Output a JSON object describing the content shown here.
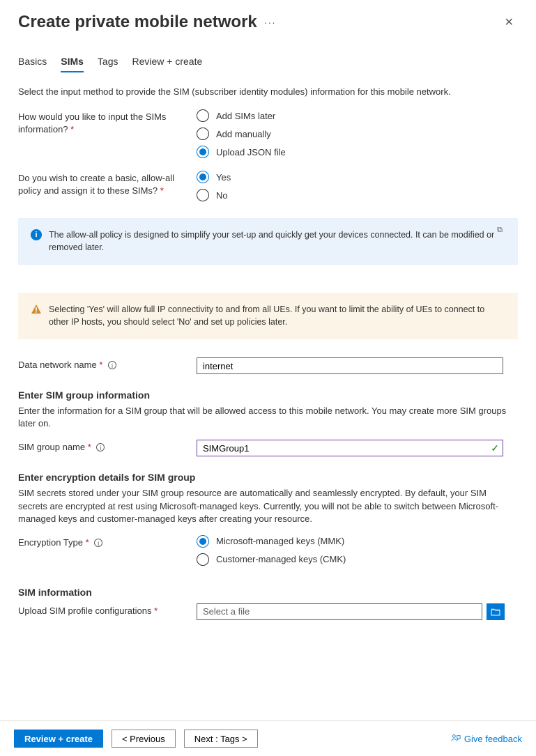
{
  "header": {
    "title": "Create private mobile network",
    "ellipsis": "···",
    "close": "✕"
  },
  "tabs": [
    "Basics",
    "SIMs",
    "Tags",
    "Review + create"
  ],
  "active_tab": "SIMs",
  "intro": "Select the input method to provide the SIM (subscriber identity modules) information for this mobile network.",
  "input_method": {
    "label": "How would you like to input the SIMs information?",
    "options": [
      "Add SIMs later",
      "Add manually",
      "Upload JSON file"
    ],
    "selected": "Upload JSON file"
  },
  "allow_all": {
    "label": "Do you wish to create a basic, allow-all policy and assign it to these SIMs?",
    "options": [
      "Yes",
      "No"
    ],
    "selected": "Yes"
  },
  "info_alert": "The allow-all policy is designed to simplify your set-up and quickly get your devices connected. It can be modified or removed later.",
  "warn_alert": "Selecting 'Yes' will allow full IP connectivity to and from all UEs. If you want to limit the ability of UEs to connect to other IP hosts, you should select 'No' and set up policies later.",
  "data_network": {
    "label": "Data network name",
    "value": "internet"
  },
  "sim_group_section": {
    "heading": "Enter SIM group information",
    "desc": "Enter the information for a SIM group that will be allowed access to this mobile network. You may create more SIM groups later on.",
    "name_label": "SIM group name",
    "name_value": "SIMGroup1"
  },
  "encryption_section": {
    "heading": "Enter encryption details for SIM group",
    "desc": "SIM secrets stored under your SIM group resource are automatically and seamlessly encrypted. By default, your SIM secrets are encrypted at rest using Microsoft-managed keys. Currently, you will not be able to switch between Microsoft-managed keys and customer-managed keys after creating your resource.",
    "label": "Encryption Type",
    "options": [
      "Microsoft-managed keys (MMK)",
      "Customer-managed keys (CMK)"
    ],
    "selected": "Microsoft-managed keys (MMK)"
  },
  "sim_info_section": {
    "heading": "SIM information",
    "upload_label": "Upload SIM profile configurations",
    "file_placeholder": "Select a file"
  },
  "footer": {
    "review": "Review + create",
    "previous": "<  Previous",
    "next": "Next : Tags  >",
    "feedback": "Give feedback"
  }
}
